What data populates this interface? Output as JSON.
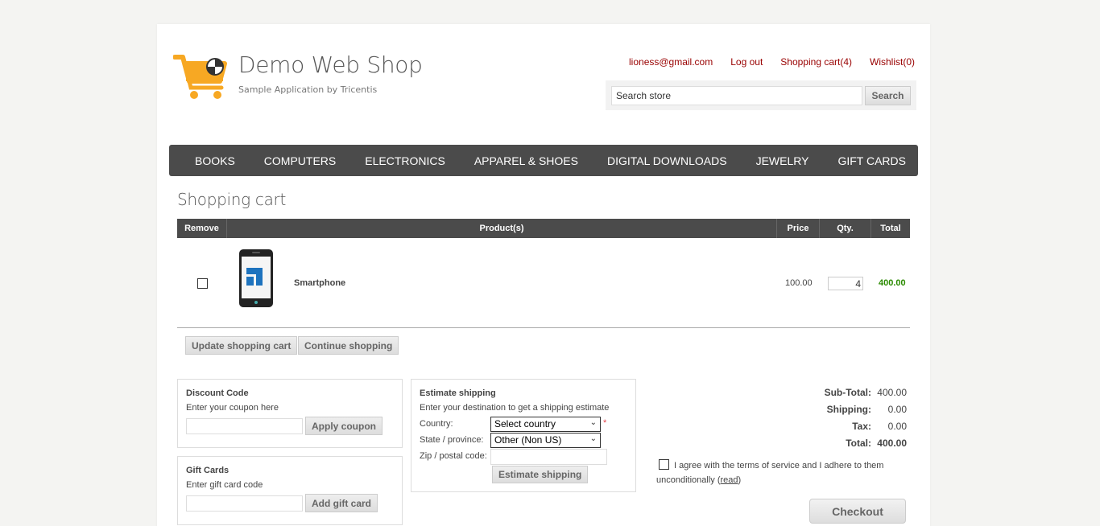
{
  "header": {
    "logo_title": "Demo Web Shop",
    "logo_subtitle": "Sample Application by Tricentis",
    "links": {
      "account": "lioness@gmail.com",
      "logout": "Log out",
      "cart": "Shopping cart(4)",
      "wishlist": "Wishlist(0)"
    },
    "search": {
      "placeholder": "Search store",
      "value": "Search store",
      "button": "Search"
    }
  },
  "menu": [
    "BOOKS",
    "COMPUTERS",
    "ELECTRONICS",
    "APPAREL & SHOES",
    "DIGITAL DOWNLOADS",
    "JEWELRY",
    "GIFT CARDS"
  ],
  "cart": {
    "title": "Shopping cart",
    "columns": {
      "remove": "Remove",
      "product": "Product(s)",
      "price": "Price",
      "qty": "Qty.",
      "total": "Total"
    },
    "items": [
      {
        "name": "Smartphone",
        "price": "100.00",
        "qty": "4",
        "total": "400.00"
      }
    ],
    "update_button": "Update shopping cart",
    "continue_button": "Continue shopping"
  },
  "discount": {
    "title": "Discount Code",
    "hint": "Enter your coupon here",
    "button": "Apply coupon"
  },
  "giftcard": {
    "title": "Gift Cards",
    "hint": "Enter gift card code",
    "button": "Add gift card"
  },
  "shipping": {
    "title": "Estimate shipping",
    "hint": "Enter your destination to get a shipping estimate",
    "country_label": "Country:",
    "country_value": "Select country",
    "state_label": "State / province:",
    "state_value": "Other (Non US)",
    "zip_label": "Zip / postal code:",
    "required_mark": "*",
    "button": "Estimate shipping"
  },
  "totals": {
    "subtotal_label": "Sub-Total:",
    "subtotal": "400.00",
    "shipping_label": "Shipping:",
    "shipping": "0.00",
    "tax_label": "Tax:",
    "tax": "0.00",
    "total_label": "Total:",
    "total": "400.00"
  },
  "terms": {
    "text": "I agree with the terms of service and I adhere to them unconditionally",
    "open": "(",
    "link": "read",
    "close": ")"
  },
  "checkout_button": "Checkout",
  "colors": {
    "link": "#990000",
    "menu_bg": "#4b4b4b",
    "total_green": "#2a8a00",
    "logo_orange": "#f7a823"
  }
}
